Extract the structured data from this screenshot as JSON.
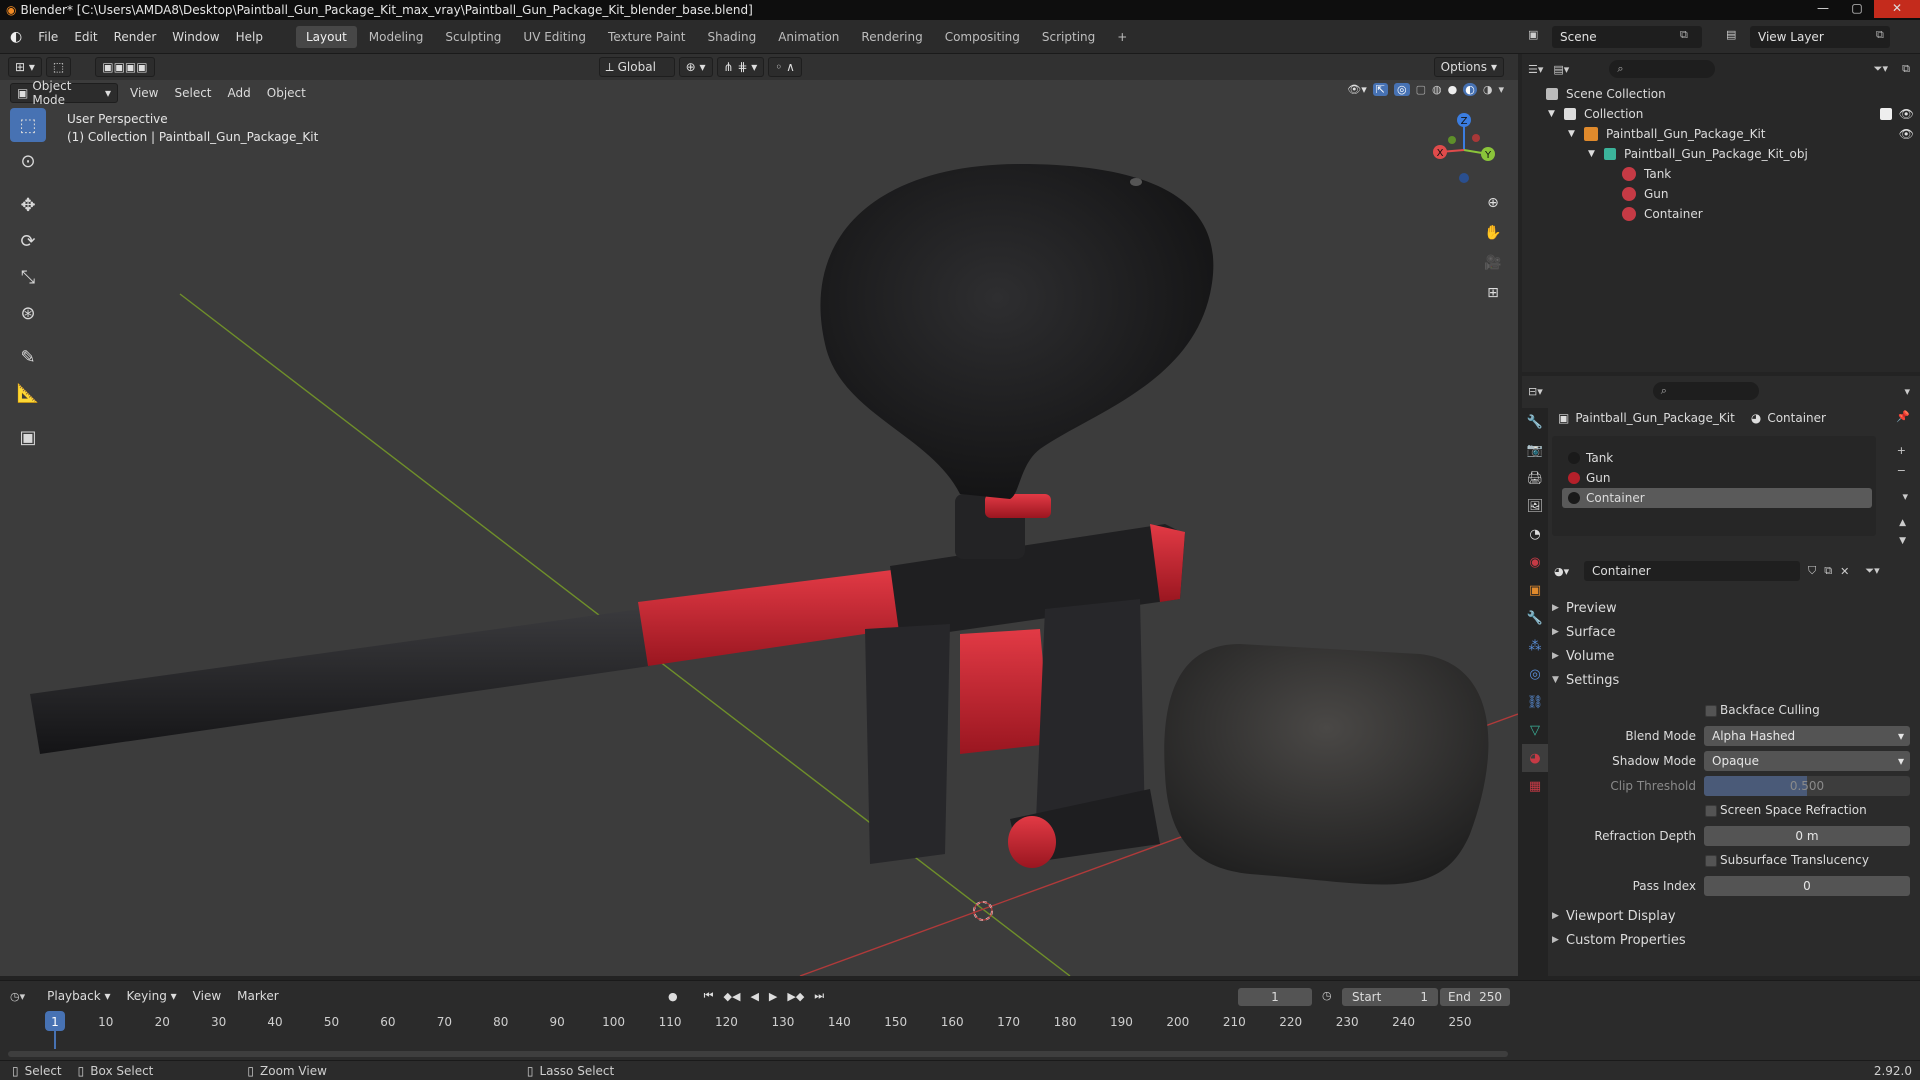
{
  "window": {
    "title": "Blender* [C:\\Users\\AMDA8\\Desktop\\Paintball_Gun_Package_Kit_max_vray\\Paintball_Gun_Package_Kit_blender_base.blend]",
    "controls": [
      "—",
      "▢",
      "✕"
    ]
  },
  "menu": [
    "File",
    "Edit",
    "Render",
    "Window",
    "Help"
  ],
  "workspaces": [
    "Layout",
    "Modeling",
    "Sculpting",
    "UV Editing",
    "Texture Paint",
    "Shading",
    "Animation",
    "Rendering",
    "Compositing",
    "Scripting",
    "+"
  ],
  "scene": {
    "label": "Scene",
    "view_layer": "View Layer"
  },
  "viewport": {
    "transform_orientation": "Global",
    "options_label": "Options",
    "mode": "Object Mode",
    "menus": [
      "View",
      "Select",
      "Add",
      "Object"
    ],
    "overlay_text_1": "User Perspective",
    "overlay_text_2": "(1) Collection | Paintball_Gun_Package_Kit",
    "gizmo_axes": {
      "x": "X",
      "y": "Y",
      "z": "Z"
    },
    "colors": {
      "background": "#3c3c3c",
      "grid_x": "#b03a3a",
      "grid_y": "#6f8f2a",
      "body_red": "#c2222d",
      "body_dark": "#232325"
    }
  },
  "outliner": {
    "rows": [
      {
        "label": "Scene Collection",
        "icon": "scene-collection-icon"
      },
      {
        "label": "Collection",
        "icon": "collection-icon"
      },
      {
        "label": "Paintball_Gun_Package_Kit",
        "icon": "object-icon"
      },
      {
        "label": "Paintball_Gun_Package_Kit_obj",
        "icon": "mesh-icon"
      },
      {
        "label": "Tank",
        "icon": "material-icon"
      },
      {
        "label": "Gun",
        "icon": "material-icon"
      },
      {
        "label": "Container",
        "icon": "material-icon"
      }
    ]
  },
  "properties": {
    "object_name": "Paintball_Gun_Package_Kit",
    "material_name": "Container",
    "slots": [
      "Tank",
      "Gun",
      "Container"
    ],
    "material_field": "Container",
    "panels": [
      "Preview",
      "Surface",
      "Volume",
      "Settings"
    ],
    "settings": {
      "backface_culling": "Backface Culling",
      "blend_mode_label": "Blend Mode",
      "blend_mode_value": "Alpha Hashed",
      "shadow_mode_label": "Shadow Mode",
      "shadow_mode_value": "Opaque",
      "clip_threshold_label": "Clip Threshold",
      "clip_threshold_value": "0.500",
      "screen_space_refraction": "Screen Space Refraction",
      "refraction_depth_label": "Refraction Depth",
      "refraction_depth_value": "0 m",
      "subsurface_translucency": "Subsurface Translucency",
      "pass_index_label": "Pass Index",
      "pass_index_value": "0"
    },
    "bottom_panels": [
      "Viewport Display",
      "Custom Properties"
    ]
  },
  "timeline": {
    "menus": [
      "Playback",
      "Keying",
      "View",
      "Marker"
    ],
    "current_frame": "1",
    "start_label": "Start",
    "start_value": "1",
    "end_label": "End",
    "end_value": "250",
    "ticks": [
      "1",
      "10",
      "20",
      "30",
      "40",
      "50",
      "60",
      "70",
      "80",
      "90",
      "100",
      "110",
      "120",
      "130",
      "140",
      "150",
      "160",
      "170",
      "180",
      "190",
      "200",
      "210",
      "220",
      "230",
      "240",
      "250"
    ]
  },
  "statusbar": {
    "items": [
      "Select",
      "Box Select",
      "Zoom View",
      "Lasso Select"
    ],
    "version": "2.92.0"
  }
}
